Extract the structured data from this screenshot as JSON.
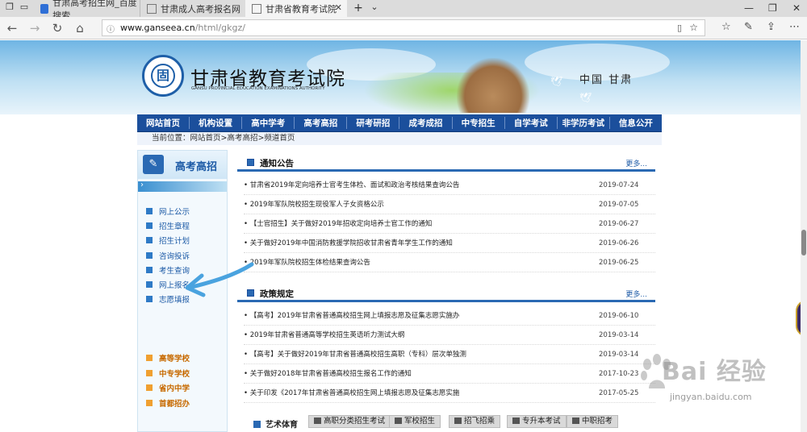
{
  "browser": {
    "tabs": [
      {
        "title": "甘肃高考招生网_百度搜索",
        "active": false
      },
      {
        "title": "甘肃成人高考报名网",
        "active": false
      },
      {
        "title": "甘肃省教育考试院",
        "active": true
      }
    ],
    "url_host": "www.ganseea.cn",
    "url_path": "/html/gkgz/"
  },
  "header": {
    "logo_char": "固",
    "title": "甘肃省教育考试院",
    "subtitle": "GANSU PROVINCIAL EDUCATION EXAMINATIONS AUTHORITY",
    "region": "中国 甘肃"
  },
  "main_nav": [
    "网站首页",
    "机构设置",
    "高中学考",
    "高考高招",
    "研考研招",
    "成考成招",
    "中专招生",
    "自学考试",
    "非学历考试",
    "信息公开"
  ],
  "breadcrumb": "当前位置：网站首页>高考高招>频道首页",
  "sidebar": {
    "title": "高考高招",
    "items": [
      "网上公示",
      "招生章程",
      "招生计划",
      "咨询投诉",
      "考生查询",
      "网上报名",
      "志愿填报"
    ],
    "links": [
      "高等学校",
      "中专学校",
      "省内中学",
      "首都招办"
    ]
  },
  "notices": {
    "title": "通知公告",
    "more": "更多...",
    "rows": [
      {
        "text": "甘肃省2019年定向培养士官考生体检、面试和政治考核结果查询公告",
        "date": "2019-07-24"
      },
      {
        "text": "2019年军队院校招生现役军人子女资格公示",
        "date": "2019-07-05"
      },
      {
        "text": "【士官招生】关于做好2019年招收定向培养士官工作的通知",
        "date": "2019-06-27"
      },
      {
        "text": "关于做好2019年中国消防救援学院招收甘肃省青年学生工作的通知",
        "date": "2019-06-26"
      },
      {
        "text": "2019年军队院校招生体检结果查询公告",
        "date": "2019-06-25"
      }
    ]
  },
  "policies": {
    "title": "政策规定",
    "more": "更多...",
    "rows": [
      {
        "text": "【高考】2019年甘肃省普通高校招生网上填报志愿及征集志愿实施办",
        "date": "2019-06-10"
      },
      {
        "text": "2019年甘肃省普通高等学校招生英语听力测试大纲",
        "date": "2019-03-14"
      },
      {
        "text": "【高考】关于做好2019年甘肃省普通高校招生高职（专科）层次单独测",
        "date": "2019-03-14"
      },
      {
        "text": "关于做好2018年甘肃省普通高校招生报名工作的通知",
        "date": "2017-10-23"
      },
      {
        "text": "关于印发《2017年甘肃省普通高校招生网上填报志愿及征集志愿实施",
        "date": "2017-05-25"
      }
    ]
  },
  "bottom_tabs": {
    "title": "艺术体育",
    "tabs": [
      "高职分类招生考试",
      "军校招生",
      "招飞招乘",
      "专升本考试",
      "中职招考"
    ]
  },
  "watermark": {
    "brand": "Bai 经验",
    "url": "jingyan.baidu.com"
  },
  "colors": {
    "nav_blue": "#1b4f9c",
    "link_blue": "#1c5aa6",
    "arrow": "#4aa3df",
    "accent_orange": "#c76a00"
  }
}
